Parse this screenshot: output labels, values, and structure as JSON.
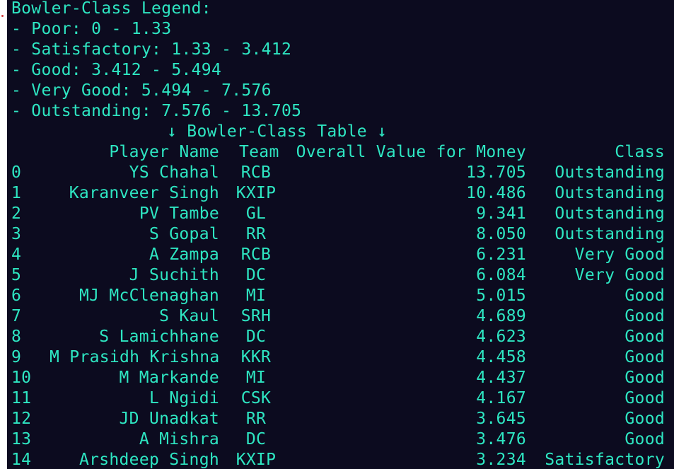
{
  "legend": {
    "title": "Bowler-Class Legend:",
    "items": [
      "- Poor: 0 - 1.33",
      "- Satisfactory: 1.33 - 3.412",
      "- Good: 3.412 - 5.494",
      "- Very Good: 5.494 - 7.576",
      "- Outstanding: 7.576 - 13.705"
    ]
  },
  "table": {
    "caption": "↓ Bowler-Class Table ↓",
    "headers": {
      "player": "Player Name",
      "team": "Team",
      "value": "Overall Value for Money",
      "class": "Class"
    },
    "rows": [
      {
        "idx": "0",
        "player": "YS Chahal",
        "team": "RCB",
        "value": "13.705",
        "class": "Outstanding"
      },
      {
        "idx": "1",
        "player": "Karanveer Singh",
        "team": "KXIP",
        "value": "10.486",
        "class": "Outstanding"
      },
      {
        "idx": "2",
        "player": "PV Tambe",
        "team": "GL",
        "value": "9.341",
        "class": "Outstanding"
      },
      {
        "idx": "3",
        "player": "S Gopal",
        "team": "RR",
        "value": "8.050",
        "class": "Outstanding"
      },
      {
        "idx": "4",
        "player": "A Zampa",
        "team": "RCB",
        "value": "6.231",
        "class": "Very Good"
      },
      {
        "idx": "5",
        "player": "J Suchith",
        "team": "DC",
        "value": "6.084",
        "class": "Very Good"
      },
      {
        "idx": "6",
        "player": "MJ McClenaghan",
        "team": "MI",
        "value": "5.015",
        "class": "Good"
      },
      {
        "idx": "7",
        "player": "S Kaul",
        "team": "SRH",
        "value": "4.689",
        "class": "Good"
      },
      {
        "idx": "8",
        "player": "S Lamichhane",
        "team": "DC",
        "value": "4.623",
        "class": "Good"
      },
      {
        "idx": "9",
        "player": "M Prasidh Krishna",
        "team": "KKR",
        "value": "4.458",
        "class": "Good"
      },
      {
        "idx": "10",
        "player": "M Markande",
        "team": "MI",
        "value": "4.437",
        "class": "Good"
      },
      {
        "idx": "11",
        "player": "L Ngidi",
        "team": "CSK",
        "value": "4.167",
        "class": "Good"
      },
      {
        "idx": "12",
        "player": "JD Unadkat",
        "team": "RR",
        "value": "3.645",
        "class": "Good"
      },
      {
        "idx": "13",
        "player": "A Mishra",
        "team": "DC",
        "value": "3.476",
        "class": "Good"
      },
      {
        "idx": "14",
        "player": "Arshdeep Singh",
        "team": "KXIP",
        "value": "3.234",
        "class": "Satisfactory"
      }
    ]
  },
  "colors": {
    "background": "#0c0b1f",
    "text": "#2ee6c2"
  }
}
